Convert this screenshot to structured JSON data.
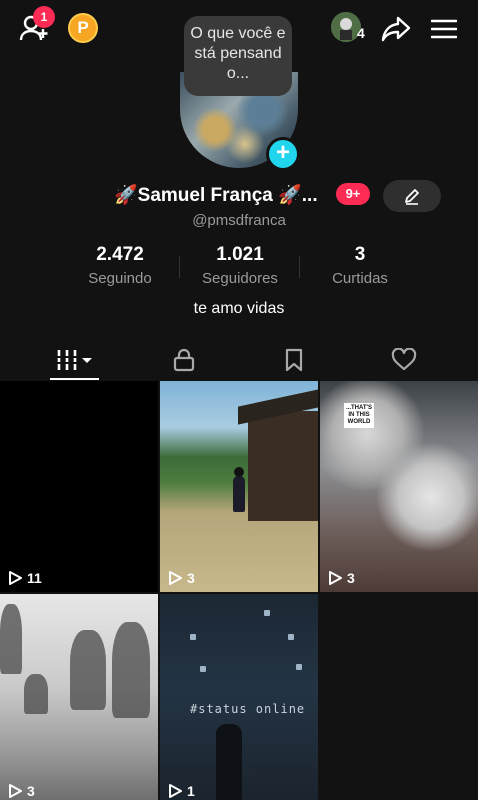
{
  "topbar": {
    "add_friends_badge": "1",
    "coin_label": "P",
    "friends_count": "4"
  },
  "avatar": {
    "status_bubble": "O que você está pensando..."
  },
  "profile": {
    "name": "🚀Samuel França 🚀...",
    "notif_badge": "9+",
    "handle": "@pmsdfranca",
    "bio": "te amo vidas"
  },
  "stats": [
    {
      "num": "2.472",
      "label": "Seguindo"
    },
    {
      "num": "1.021",
      "label": "Seguidores"
    },
    {
      "num": "3",
      "label": "Curtidas"
    }
  ],
  "tabs": [
    {
      "icon": "grid-icon",
      "active": true
    },
    {
      "icon": "lock-icon",
      "active": false
    },
    {
      "icon": "bookmark-icon",
      "active": false
    },
    {
      "icon": "heart-icon",
      "active": false
    }
  ],
  "videos": [
    {
      "plays": "11"
    },
    {
      "plays": "3"
    },
    {
      "plays": "3",
      "overlay_text": "...THAT'S IN THIS WORLD"
    },
    {
      "plays": "3"
    },
    {
      "plays": "1",
      "overlay_text": "#status online"
    }
  ],
  "colors": {
    "background": "#121212",
    "accent_red": "#fe2c55",
    "accent_cyan": "#20d5ec",
    "coin": "#f6a623"
  }
}
